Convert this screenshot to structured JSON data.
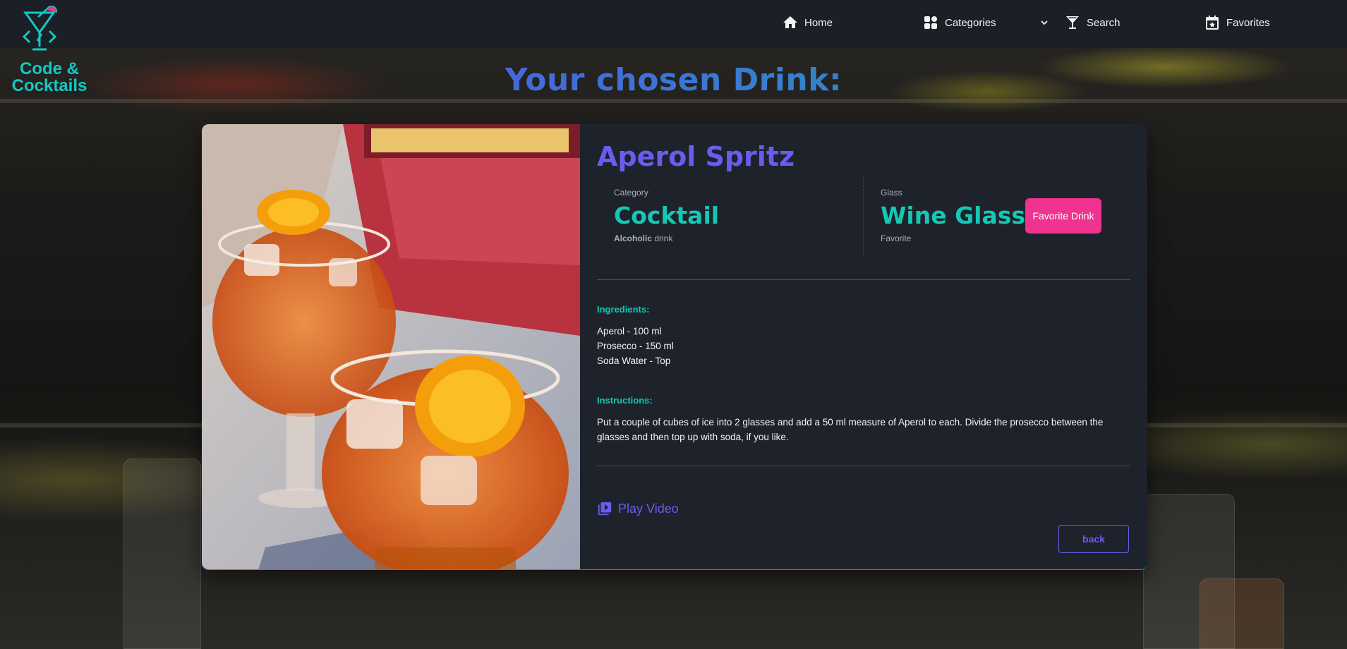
{
  "logo": {
    "line1": "Code &",
    "line2": "Cocktails"
  },
  "nav": {
    "home": "Home",
    "categories": "Categories",
    "search": "Search",
    "favorites": "Favorites"
  },
  "page": {
    "title": "Your chosen Drink:"
  },
  "drink": {
    "name": "Aperol Spritz",
    "category_label": "Category",
    "category": "Cocktail",
    "alcoholic": "Alcoholic",
    "alcoholic_suffix": " drink",
    "glass_label": "Glass",
    "glass": "Wine Glass",
    "glass_desc": "Favorite",
    "favorite_button": "Favorite Drink",
    "ingredients_label": "Ingredients:",
    "ingredients": [
      "Aperol - 100 ml",
      "Prosecco - 150 ml",
      "Soda Water - Top"
    ],
    "instructions_label": "Instructions:",
    "instructions": "Put a couple of cubes of ice into 2 glasses and add a 50 ml measure of Aperol to each. Divide the prosecco between the glasses and then top up with soda, if you like.",
    "play_video": "Play Video",
    "back_button": "back"
  },
  "colors": {
    "accent_teal": "#14c8b4",
    "accent_purple": "#6b5cf0",
    "favorite_pink": "#f0338f",
    "card_bg": "#1e222a",
    "nav_bg": "#1b1f26"
  }
}
